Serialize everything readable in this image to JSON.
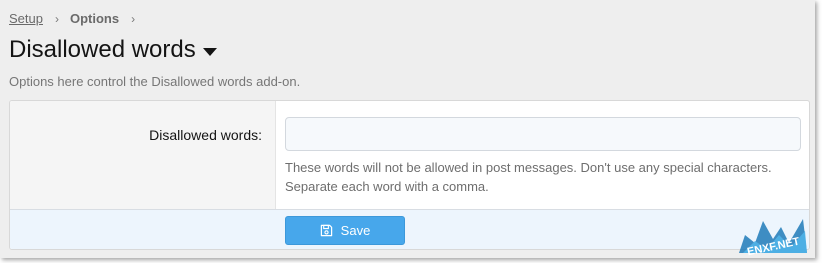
{
  "breadcrumb": {
    "items": [
      {
        "label": "Setup"
      },
      {
        "label": "Options"
      }
    ],
    "separator": "›"
  },
  "page": {
    "title": "Disallowed words",
    "description": "Options here control the Disallowed words add-on."
  },
  "form": {
    "field_label": "Disallowed words:",
    "field_value": "",
    "hint": "These words will not be allowed in post messages. Don't use any special characters. Separate each word with a comma.",
    "save_label": "Save"
  },
  "colors": {
    "accent": "#47a7eb",
    "submit_bg": "#edf5fd",
    "page_bg": "#eeeeee"
  },
  "icons": {
    "title_menu": "caret-down-icon",
    "save": "floppy-disk-icon"
  },
  "watermark": {
    "text": "ENXF.NET"
  }
}
